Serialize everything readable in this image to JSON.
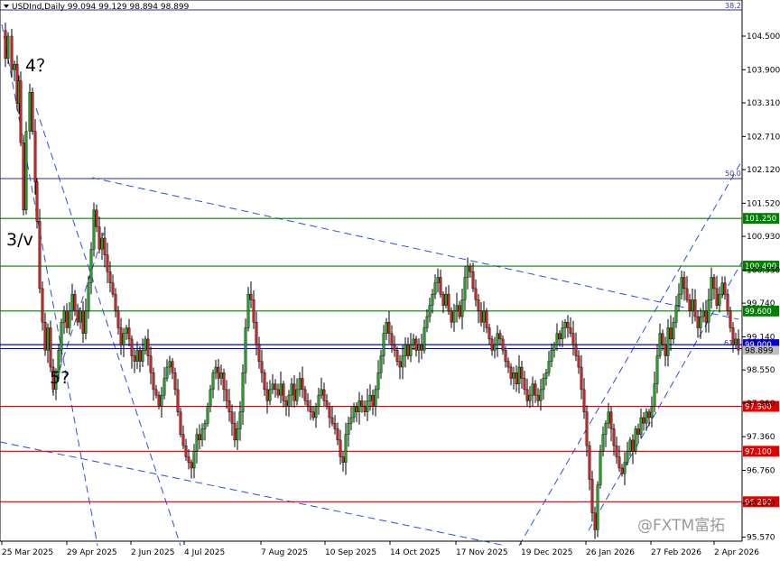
{
  "header": {
    "title": "USDInd,Daily  99.094 99.129 98.894 98.899"
  },
  "watermark": "@FXTM富拓",
  "chart_data": {
    "type": "candlestick",
    "symbol": "USDInd",
    "timeframe": "Daily",
    "ohlc": {
      "open": 99.094,
      "high": 99.129,
      "low": 98.894,
      "close": 98.899
    },
    "ylim": [
      95.5,
      105.0
    ],
    "y_ticks": [
      "104.500",
      "103.900",
      "103.310",
      "102.710",
      "102.120",
      "101.520",
      "100.930",
      "100.330",
      "99.740",
      "99.140",
      "98.550",
      "97.960",
      "97.360",
      "96.760",
      "96.170",
      "95.570"
    ],
    "x_ticks": [
      "25 Mar 2025",
      "29 Apr 2025",
      "2 Jun 2025",
      "4 Jul 2025",
      "7 Aug 2025",
      "10 Sep 2025",
      "14 Oct 2025",
      "17 Nov 2025",
      "19 Dec 2025",
      "26 Jan 2026",
      "27 Feb 2026",
      "2 Apr 2026"
    ],
    "price_levels": [
      {
        "label": "101.250",
        "value": 101.25,
        "color": "#008000"
      },
      {
        "label": "100.400",
        "value": 100.4,
        "color": "#008000"
      },
      {
        "label": "99.600",
        "value": 99.6,
        "color": "#008000"
      },
      {
        "label": "99.000",
        "value": 99.0,
        "color": "#0000cc"
      },
      {
        "label": "97.900",
        "value": 97.9,
        "color": "#e00000"
      },
      {
        "label": "97.100",
        "value": 97.1,
        "color": "#e00000"
      },
      {
        "label": "96.200",
        "value": 96.2,
        "color": "#e00000"
      }
    ],
    "current_price_label": "98.899",
    "fib_labels": {
      "top": "38.2",
      "mid": "50.0",
      "low": "61.8"
    },
    "wave_labels": {
      "w4": "4？",
      "w3": "3/v",
      "w5": "5?"
    },
    "ohlc_path": [
      [
        0,
        104.6
      ],
      [
        3,
        104.1
      ],
      [
        6,
        104.5
      ],
      [
        10,
        103.9
      ],
      [
        13,
        104.0
      ],
      [
        16,
        103.3
      ],
      [
        18,
        103.7
      ],
      [
        20,
        102.6
      ],
      [
        23,
        101.4
      ],
      [
        26,
        102.8
      ],
      [
        30,
        103.5
      ],
      [
        33,
        102.8
      ],
      [
        36,
        101.9
      ],
      [
        38,
        101.2
      ],
      [
        41,
        100.0
      ],
      [
        44,
        99.4
      ],
      [
        47,
        98.9
      ],
      [
        50,
        99.3
      ],
      [
        53,
        98.6
      ],
      [
        56,
        98.2
      ],
      [
        59,
        98.5
      ],
      [
        62,
        98.9
      ],
      [
        65,
        99.4
      ],
      [
        68,
        99.6
      ],
      [
        71,
        99.3
      ],
      [
        74,
        99.6
      ],
      [
        77,
        99.9
      ],
      [
        80,
        99.6
      ],
      [
        83,
        99.4
      ],
      [
        86,
        99.6
      ],
      [
        89,
        99.2
      ],
      [
        92,
        99.6
      ],
      [
        95,
        100.1
      ],
      [
        98,
        100.7
      ],
      [
        101,
        101.4
      ],
      [
        104,
        101.1
      ],
      [
        107,
        100.7
      ],
      [
        110,
        100.9
      ],
      [
        113,
        100.6
      ],
      [
        116,
        100.3
      ],
      [
        119,
        100.1
      ],
      [
        122,
        99.9
      ],
      [
        125,
        99.6
      ],
      [
        128,
        99.3
      ],
      [
        131,
        99.0
      ],
      [
        134,
        99.2
      ],
      [
        137,
        99.3
      ],
      [
        140,
        99.1
      ],
      [
        143,
        98.8
      ],
      [
        146,
        98.7
      ],
      [
        149,
        98.9
      ],
      [
        152,
        98.7
      ],
      [
        155,
        98.9
      ],
      [
        158,
        99.1
      ],
      [
        161,
        98.8
      ],
      [
        164,
        98.5
      ],
      [
        167,
        98.2
      ],
      [
        170,
        98.1
      ],
      [
        173,
        97.9
      ],
      [
        176,
        98.1
      ],
      [
        179,
        98.4
      ],
      [
        182,
        98.6
      ],
      [
        185,
        98.7
      ],
      [
        188,
        98.5
      ],
      [
        191,
        98.2
      ],
      [
        194,
        97.8
      ],
      [
        197,
        97.4
      ],
      [
        200,
        97.2
      ],
      [
        203,
        97.0
      ],
      [
        206,
        96.9
      ],
      [
        209,
        96.8
      ],
      [
        212,
        97.1
      ],
      [
        215,
        97.4
      ],
      [
        218,
        97.3
      ],
      [
        221,
        97.5
      ],
      [
        224,
        97.6
      ],
      [
        227,
        97.9
      ],
      [
        230,
        98.2
      ],
      [
        233,
        98.5
      ],
      [
        236,
        98.6
      ],
      [
        239,
        98.4
      ],
      [
        242,
        98.5
      ],
      [
        245,
        98.2
      ],
      [
        248,
        98.0
      ],
      [
        251,
        97.8
      ],
      [
        254,
        97.6
      ],
      [
        257,
        97.3
      ],
      [
        260,
        97.5
      ],
      [
        263,
        97.8
      ],
      [
        266,
        98.5
      ],
      [
        269,
        99.3
      ],
      [
        272,
        99.9
      ],
      [
        275,
        99.8
      ],
      [
        278,
        99.4
      ],
      [
        281,
        99.0
      ],
      [
        284,
        98.7
      ],
      [
        287,
        98.5
      ],
      [
        290,
        98.2
      ],
      [
        293,
        98.0
      ],
      [
        296,
        98.2
      ],
      [
        299,
        98.3
      ],
      [
        302,
        98.2
      ],
      [
        305,
        98.1
      ],
      [
        308,
        98.3
      ],
      [
        311,
        98.0
      ],
      [
        314,
        97.9
      ],
      [
        317,
        98.1
      ],
      [
        320,
        98.3
      ],
      [
        323,
        98.0
      ],
      [
        326,
        98.2
      ],
      [
        329,
        98.4
      ],
      [
        332,
        98.2
      ],
      [
        335,
        98.0
      ],
      [
        338,
        97.9
      ],
      [
        341,
        97.8
      ],
      [
        344,
        97.7
      ],
      [
        347,
        97.9
      ],
      [
        350,
        98.1
      ],
      [
        353,
        98.2
      ],
      [
        356,
        98.0
      ],
      [
        359,
        97.9
      ],
      [
        362,
        97.7
      ],
      [
        365,
        97.6
      ],
      [
        368,
        97.5
      ],
      [
        371,
        97.3
      ],
      [
        374,
        97.0
      ],
      [
        377,
        96.9
      ],
      [
        380,
        97.4
      ],
      [
        383,
        97.6
      ],
      [
        386,
        97.7
      ],
      [
        389,
        97.9
      ],
      [
        392,
        97.8
      ],
      [
        395,
        98.0
      ],
      [
        398,
        97.9
      ],
      [
        401,
        97.8
      ],
      [
        404,
        98.0
      ],
      [
        407,
        98.1
      ],
      [
        410,
        97.9
      ],
      [
        413,
        98.2
      ],
      [
        416,
        98.5
      ],
      [
        419,
        98.8
      ],
      [
        422,
        99.2
      ],
      [
        425,
        99.4
      ],
      [
        428,
        99.2
      ],
      [
        431,
        99.0
      ],
      [
        434,
        98.9
      ],
      [
        437,
        98.7
      ],
      [
        440,
        98.6
      ],
      [
        443,
        98.8
      ],
      [
        446,
        99.0
      ],
      [
        449,
        98.8
      ],
      [
        452,
        99.0
      ],
      [
        455,
        99.1
      ],
      [
        458,
        98.9
      ],
      [
        461,
        99.0
      ],
      [
        464,
        98.9
      ],
      [
        467,
        99.3
      ],
      [
        470,
        99.5
      ],
      [
        473,
        99.7
      ],
      [
        476,
        99.9
      ],
      [
        479,
        100.1
      ],
      [
        482,
        100.2
      ],
      [
        485,
        99.9
      ],
      [
        488,
        99.7
      ],
      [
        491,
        99.9
      ],
      [
        494,
        99.6
      ],
      [
        497,
        99.4
      ],
      [
        500,
        99.6
      ],
      [
        503,
        99.7
      ],
      [
        506,
        99.5
      ],
      [
        509,
        99.8
      ],
      [
        512,
        100.2
      ],
      [
        515,
        100.4
      ],
      [
        518,
        100.3
      ],
      [
        521,
        100.0
      ],
      [
        524,
        99.8
      ],
      [
        527,
        99.6
      ],
      [
        530,
        99.4
      ],
      [
        533,
        99.6
      ],
      [
        536,
        99.3
      ],
      [
        539,
        99.1
      ],
      [
        542,
        98.9
      ],
      [
        545,
        99.0
      ],
      [
        548,
        99.2
      ],
      [
        551,
        99.1
      ],
      [
        554,
        98.9
      ],
      [
        557,
        98.7
      ],
      [
        560,
        98.6
      ],
      [
        563,
        98.4
      ],
      [
        566,
        98.5
      ],
      [
        569,
        98.3
      ],
      [
        572,
        98.6
      ],
      [
        575,
        98.4
      ],
      [
        578,
        98.2
      ],
      [
        581,
        98.0
      ],
      [
        584,
        98.1
      ],
      [
        587,
        98.3
      ],
      [
        590,
        98.1
      ],
      [
        593,
        98.0
      ],
      [
        596,
        98.2
      ],
      [
        599,
        98.4
      ],
      [
        602,
        98.5
      ],
      [
        605,
        98.7
      ],
      [
        608,
        98.9
      ],
      [
        611,
        99.0
      ],
      [
        614,
        99.2
      ],
      [
        617,
        99.1
      ],
      [
        620,
        99.3
      ],
      [
        623,
        99.4
      ],
      [
        626,
        99.3
      ],
      [
        629,
        99.2
      ],
      [
        632,
        99.0
      ],
      [
        635,
        98.8
      ],
      [
        638,
        98.6
      ],
      [
        641,
        98.2
      ],
      [
        644,
        97.8
      ],
      [
        647,
        97.2
      ],
      [
        650,
        96.6
      ],
      [
        653,
        96.0
      ],
      [
        656,
        95.7
      ],
      [
        659,
        96.5
      ],
      [
        662,
        97.1
      ],
      [
        665,
        97.4
      ],
      [
        668,
        97.6
      ],
      [
        671,
        97.8
      ],
      [
        674,
        97.5
      ],
      [
        677,
        97.2
      ],
      [
        680,
        97.0
      ],
      [
        683,
        96.8
      ],
      [
        686,
        96.7
      ],
      [
        689,
        96.9
      ],
      [
        692,
        97.1
      ],
      [
        695,
        97.3
      ],
      [
        698,
        97.1
      ],
      [
        701,
        97.5
      ],
      [
        704,
        97.4
      ],
      [
        707,
        97.7
      ],
      [
        710,
        97.6
      ],
      [
        713,
        97.8
      ],
      [
        716,
        97.7
      ],
      [
        719,
        97.9
      ],
      [
        722,
        98.3
      ],
      [
        725,
        98.8
      ],
      [
        728,
        99.2
      ],
      [
        731,
        99.0
      ],
      [
        734,
        98.8
      ],
      [
        737,
        99.3
      ],
      [
        740,
        99.1
      ],
      [
        743,
        99.4
      ],
      [
        746,
        99.7
      ],
      [
        749,
        99.9
      ],
      [
        752,
        100.2
      ],
      [
        755,
        100.0
      ],
      [
        758,
        99.8
      ],
      [
        761,
        99.6
      ],
      [
        764,
        99.8
      ],
      [
        767,
        99.5
      ],
      [
        770,
        99.3
      ],
      [
        773,
        99.5
      ],
      [
        776,
        99.6
      ],
      [
        779,
        99.4
      ],
      [
        782,
        99.8
      ],
      [
        785,
        100.2
      ],
      [
        788,
        100.0
      ],
      [
        791,
        99.7
      ],
      [
        794,
        99.9
      ],
      [
        797,
        100.1
      ],
      [
        800,
        99.9
      ],
      [
        803,
        99.6
      ],
      [
        806,
        99.3
      ],
      [
        809,
        99.0
      ],
      [
        812,
        99.1
      ],
      [
        815,
        98.9
      ]
    ]
  }
}
